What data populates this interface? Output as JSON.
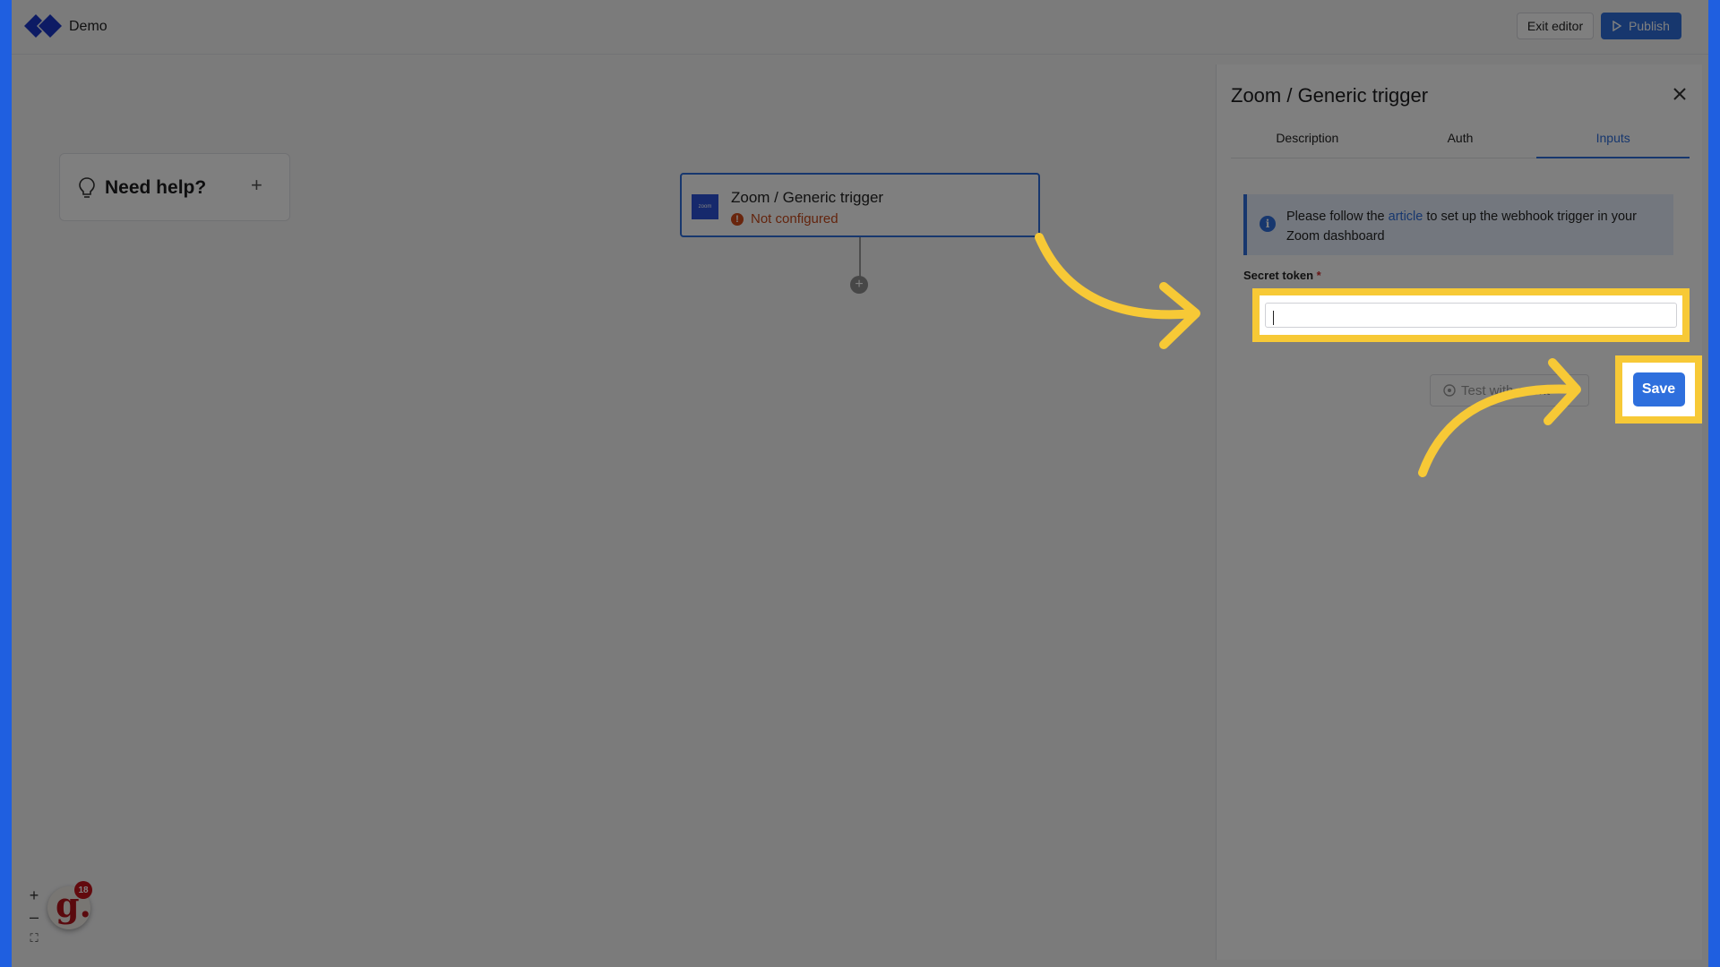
{
  "header": {
    "app_name": "Demo",
    "exit_label": "Exit editor",
    "publish_label": "Publish"
  },
  "help": {
    "title": "Need help?",
    "plus": "+"
  },
  "node": {
    "title": "Zoom / Generic trigger",
    "status": "Not configured",
    "icon_text": "zoom",
    "add_symbol": "+"
  },
  "panel": {
    "title": "Zoom / Generic trigger",
    "tabs": [
      {
        "label": "Description"
      },
      {
        "label": "Auth"
      },
      {
        "label": "Inputs"
      }
    ],
    "active_tab": "Inputs",
    "info": {
      "prefix": "Please follow the ",
      "link": "article",
      "suffix": " to set up the webhook trigger in your Zoom dashboard"
    },
    "field_label": "Secret token",
    "required_mark": "*",
    "token_value": "",
    "test_label": "Test with event",
    "save_label": "Save"
  },
  "zoom_controls": {
    "zoom_in": "+",
    "zoom_out": "–",
    "fit": "⛶"
  },
  "badge": {
    "letter": "g.",
    "count": "18"
  },
  "colors": {
    "accent": "#2e6fdd",
    "highlight": "#f7c936",
    "warning": "#c7481a",
    "frame": "#1f5fe0"
  }
}
